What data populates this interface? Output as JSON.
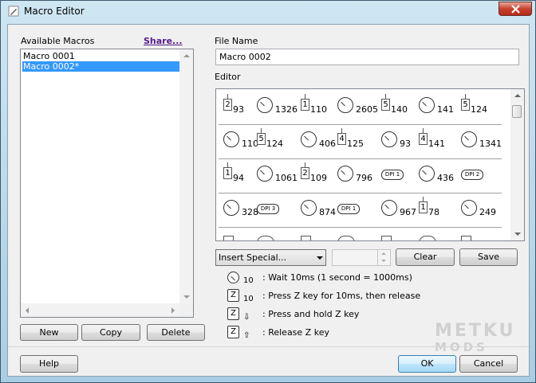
{
  "window": {
    "title": "Macro Editor"
  },
  "macros": {
    "label": "Available Macros",
    "share": "Share...",
    "items": [
      {
        "label": "Macro 0001",
        "selected": false
      },
      {
        "label": "Macro 0002*",
        "selected": true
      }
    ],
    "new": "New",
    "copy": "Copy",
    "delete": "Delete"
  },
  "file_name": {
    "label": "File Name",
    "value": "Macro 0002"
  },
  "editor": {
    "label": "Editor",
    "rows": [
      [
        {
          "k": "key",
          "key": "2",
          "v": "93"
        },
        {
          "k": "wait",
          "v": "1326"
        },
        {
          "k": "key",
          "key": "1",
          "v": "110"
        },
        {
          "k": "wait",
          "v": "2605"
        },
        {
          "k": "key",
          "key": "5",
          "v": "140"
        },
        {
          "k": "wait",
          "v": "141"
        },
        {
          "k": "key",
          "key": "5",
          "v": "124"
        }
      ],
      [
        {
          "k": "wait",
          "v": "110"
        },
        {
          "k": "key",
          "key": "5",
          "v": "124"
        },
        {
          "k": "wait",
          "v": "406"
        },
        {
          "k": "key",
          "key": "4",
          "v": "125"
        },
        {
          "k": "wait",
          "v": "93"
        },
        {
          "k": "key",
          "key": "4",
          "v": "141"
        },
        {
          "k": "wait",
          "v": "1341"
        }
      ],
      [
        {
          "k": "key",
          "key": "1",
          "v": "94"
        },
        {
          "k": "wait",
          "v": "1061"
        },
        {
          "k": "key",
          "key": "2",
          "v": "109"
        },
        {
          "k": "wait",
          "v": "796"
        },
        {
          "k": "dpi",
          "v": "DPI 1"
        },
        {
          "k": "wait",
          "v": "436"
        },
        {
          "k": "dpi",
          "v": "DPI 2"
        }
      ],
      [
        {
          "k": "wait",
          "v": "328"
        },
        {
          "k": "dpi",
          "v": "DPI 3"
        },
        {
          "k": "wait",
          "v": "874"
        },
        {
          "k": "dpi",
          "v": "DPI 1"
        },
        {
          "k": "wait",
          "v": "967"
        },
        {
          "k": "key",
          "key": "1",
          "v": "78"
        },
        {
          "k": "wait",
          "v": "249"
        }
      ]
    ]
  },
  "controls": {
    "insert_special": "Insert Special...",
    "clear": "Clear",
    "save": "Save"
  },
  "legend": [
    {
      "icon": "clock-icon",
      "sub": "10",
      "text": ": Wait 10ms (1 second = 1000ms)"
    },
    {
      "icon": "Z",
      "sub": "10",
      "text": ": Press Z key for 10ms, then release"
    },
    {
      "icon": "Z",
      "sub": "⇩",
      "text": ": Press and hold Z key"
    },
    {
      "icon": "Z",
      "sub": "⇧",
      "text": ": Release Z key"
    }
  ],
  "watermark": {
    "line1": "METKU",
    "line2": "MODS"
  },
  "footer": {
    "help": "Help",
    "ok": "OK",
    "cancel": "Cancel"
  }
}
